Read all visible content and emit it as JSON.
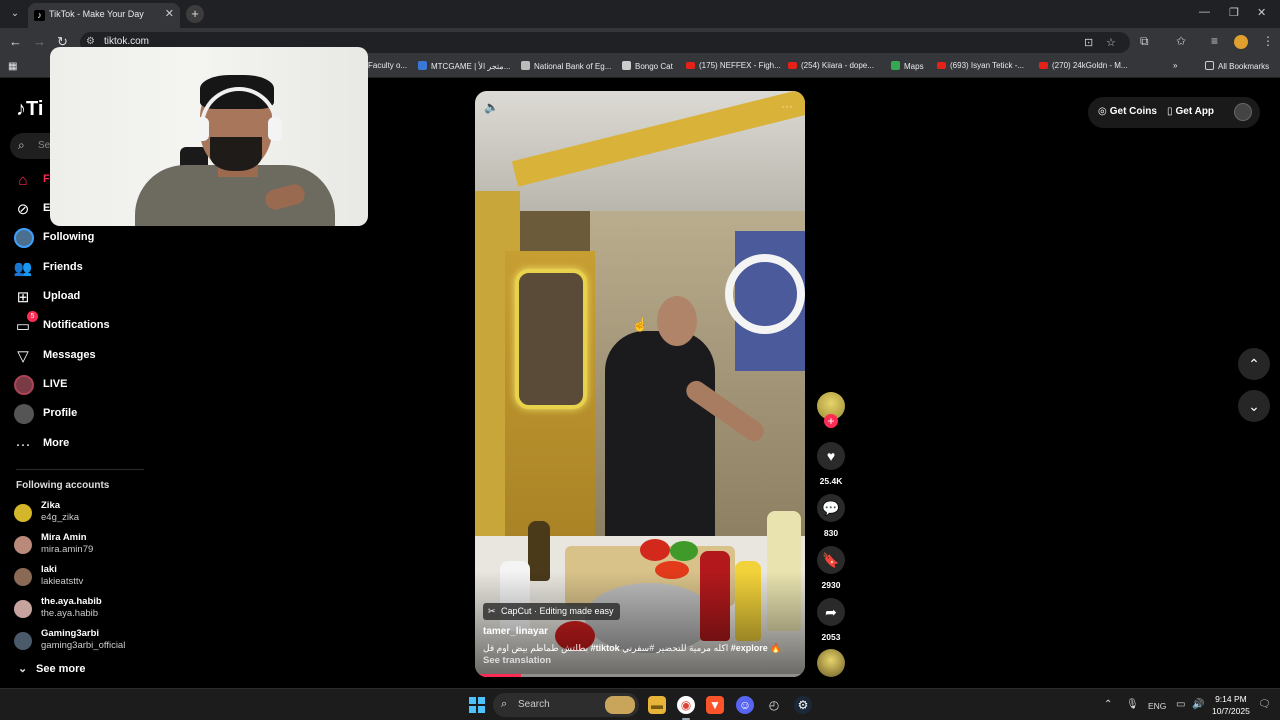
{
  "browser": {
    "tab_title": "TikTok - Make Your Day",
    "url": "tiktok.com",
    "bookmarks": [
      {
        "label": "Faculty o...",
        "icon": "generic"
      },
      {
        "label": "MTCGAME | متجر الأ...",
        "icon": "generic"
      },
      {
        "label": "National Bank of Eg...",
        "icon": "generic"
      },
      {
        "label": "Bongo Cat",
        "icon": "generic"
      },
      {
        "label": "(175) NEFFEX - Figh...",
        "icon": "youtube"
      },
      {
        "label": "(254) Kiiara - dope...",
        "icon": "youtube"
      },
      {
        "label": "Maps",
        "icon": "maps"
      },
      {
        "label": "(693) Isyan Tetick -...",
        "icon": "youtube"
      },
      {
        "label": "(270) 24kGoldn - M...",
        "icon": "youtube"
      }
    ],
    "all_bookmarks": "All Bookmarks",
    "more_bookmarks": "»"
  },
  "sidebar": {
    "logo": "Ti",
    "search_placeholder": "Sea",
    "nav": [
      {
        "label": "F",
        "icon": "home-icon",
        "active": true
      },
      {
        "label": "E",
        "icon": "compass-icon"
      },
      {
        "label": "Following",
        "icon": "following-avatar"
      },
      {
        "label": "Friends",
        "icon": "friends-icon"
      },
      {
        "label": "Upload",
        "icon": "upload-icon"
      },
      {
        "label": "Notifications",
        "icon": "notification-icon",
        "badge": "5"
      },
      {
        "label": "Messages",
        "icon": "send-icon"
      },
      {
        "label": "LIVE",
        "icon": "live-avatar"
      },
      {
        "label": "Profile",
        "icon": "profile-avatar"
      },
      {
        "label": "More",
        "icon": "more-icon"
      }
    ],
    "following_title": "Following accounts",
    "accounts": [
      {
        "name": "Zika",
        "handle": "e4g_zika",
        "color": "#d4b62a"
      },
      {
        "name": "Mira Amin",
        "handle": "mira.amin79",
        "color": "#b98a7a"
      },
      {
        "name": "laki",
        "handle": "lakieatsttv",
        "color": "#8a6a55"
      },
      {
        "name": "the.aya.habib",
        "handle": "the.aya.habib",
        "color": "#c7a3a0"
      },
      {
        "name": "Gaming3arbi",
        "handle": "gaming3arbi_official",
        "color": "#4a5a6a"
      }
    ],
    "see_more": "See more"
  },
  "video": {
    "capcut_label": "CapCut · Editing made easy",
    "author": "tamer_linayar",
    "caption_prefix": "بطلتش طماطم بيض اوم فل",
    "caption_tag1": "#tiktok",
    "caption_mid": "اكله مرمية للتحضير #سفرني",
    "caption_tag2": "#explore",
    "caption_emoji": "🔥✨",
    "see_translation": "See translation",
    "progress": 0.14
  },
  "actions": {
    "likes": "25.4K",
    "comments": "830",
    "saves": "2930",
    "shares": "2053"
  },
  "topbar": {
    "get_coins": "Get Coins",
    "get_app": "Get App"
  },
  "taskbar": {
    "search_label": "Search",
    "language": "ENG",
    "time": "9:14 PM",
    "date": "10/7/2025"
  },
  "colors": {
    "accent": "#fe2c55",
    "background": "#000000"
  }
}
